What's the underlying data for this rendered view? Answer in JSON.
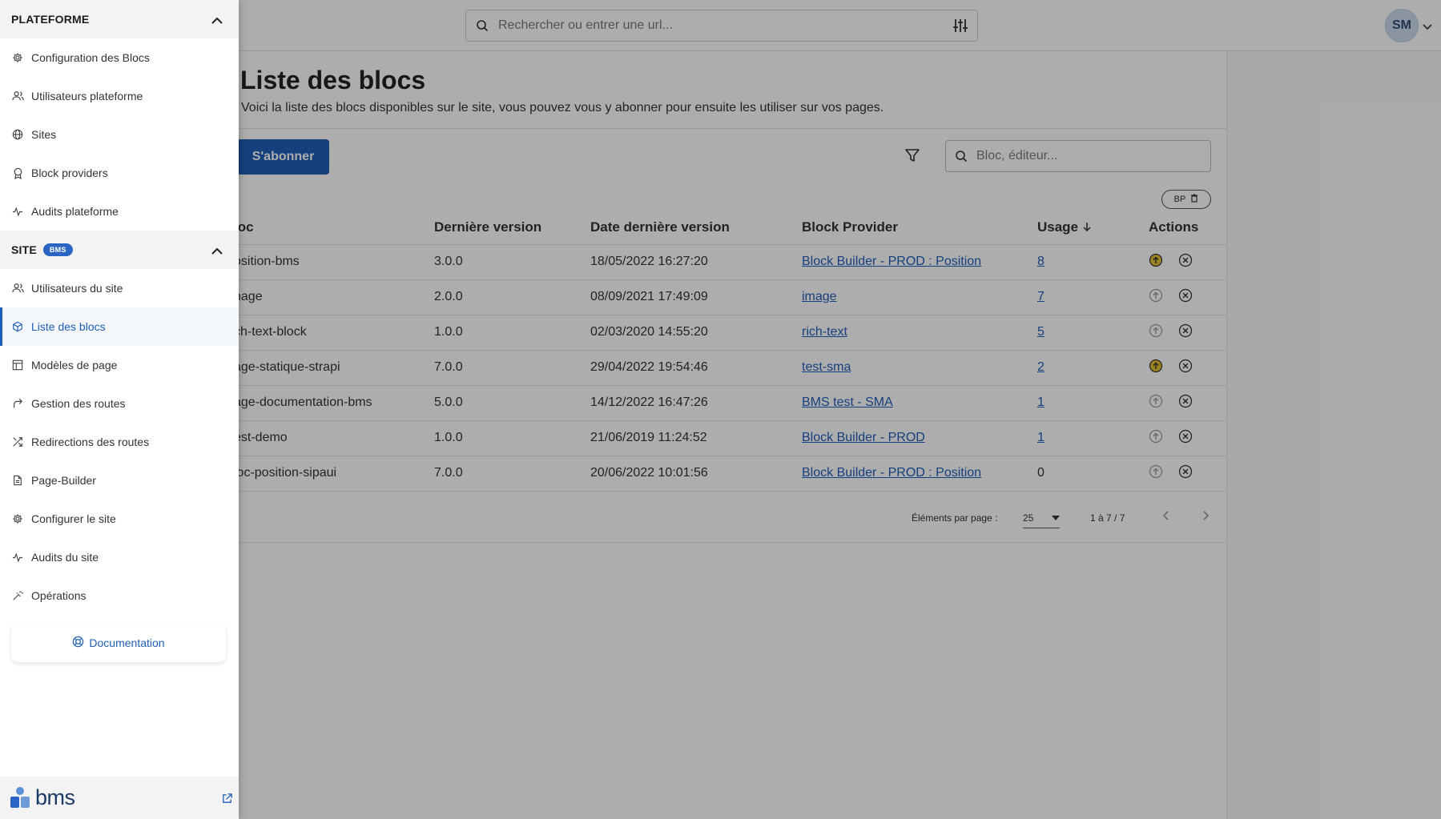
{
  "topbar": {
    "search_placeholder": "Rechercher ou entrer une url...",
    "avatar_initials": "SM"
  },
  "page": {
    "title": "Liste des blocs",
    "description": "Voici la liste des blocs disponibles sur le site, vous pouvez vous y abonner pour ensuite les utiliser sur vos pages.",
    "subscribe_label": "S'abonner",
    "bloc_search_placeholder": "Bloc, éditeur...",
    "bp_chip": "BP"
  },
  "table": {
    "headers": [
      "loc",
      "Dernière version",
      "Date dernière version",
      "Block Provider",
      "Usage",
      "Actions"
    ],
    "rows": [
      {
        "bloc": "osition-bms",
        "version": "3.0.0",
        "date": "18/05/2022 16:27:20",
        "provider": "Block Builder - PROD : Position",
        "usage": "8",
        "upgrade": true
      },
      {
        "bloc": "nage",
        "version": "2.0.0",
        "date": "08/09/2021 17:49:09",
        "provider": "image",
        "usage": "7",
        "upgrade": false
      },
      {
        "bloc": "ch-text-block",
        "version": "1.0.0",
        "date": "02/03/2020 14:55:20",
        "provider": "rich-text",
        "usage": "5",
        "upgrade": false
      },
      {
        "bloc": "age-statique-strapi",
        "version": "7.0.0",
        "date": "29/04/2022 19:54:46",
        "provider": "test-sma",
        "usage": "2",
        "upgrade": true
      },
      {
        "bloc": "age-documentation-bms",
        "version": "5.0.0",
        "date": "14/12/2022 16:47:26",
        "provider": "BMS test - SMA",
        "usage": "1",
        "upgrade": false
      },
      {
        "bloc": "est-demo",
        "version": "1.0.0",
        "date": "21/06/2019 11:24:52",
        "provider": "Block Builder - PROD",
        "usage": "1",
        "upgrade": false
      },
      {
        "bloc": "loc-position-sipaui",
        "version": "7.0.0",
        "date": "20/06/2022 10:01:56",
        "provider": "Block Builder - PROD : Position",
        "usage": "0",
        "upgrade": false
      }
    ]
  },
  "pager": {
    "per_page_label": "Éléments par page :",
    "per_page_value": "25",
    "range": "1 à 7 / 7"
  },
  "sidebar": {
    "platform": {
      "title": "PLATEFORME",
      "items": [
        {
          "label": "Configuration des Blocs",
          "icon": "gear-icon"
        },
        {
          "label": "Utilisateurs plateforme",
          "icon": "users-icon"
        },
        {
          "label": "Sites",
          "icon": "globe-icon"
        },
        {
          "label": "Block providers",
          "icon": "award-icon"
        },
        {
          "label": "Audits plateforme",
          "icon": "activity-icon"
        }
      ]
    },
    "site": {
      "title": "SITE",
      "badge": "BMS",
      "items": [
        {
          "label": "Utilisateurs du site",
          "icon": "users-icon"
        },
        {
          "label": "Liste des blocs",
          "icon": "cube-icon"
        },
        {
          "label": "Modèles de page",
          "icon": "layout-icon"
        },
        {
          "label": "Gestion des routes",
          "icon": "route-icon"
        },
        {
          "label": "Redirections des routes",
          "icon": "shuffle-icon"
        },
        {
          "label": "Page-Builder",
          "icon": "file-icon"
        },
        {
          "label": "Configurer le site",
          "icon": "gear-icon"
        },
        {
          "label": "Audits du site",
          "icon": "activity-icon"
        },
        {
          "label": "Opérations",
          "icon": "wand-icon"
        }
      ]
    },
    "documentation_label": "Documentation",
    "logo_text": "bms"
  },
  "colors": {
    "primary": "#1f5eb8",
    "upgrade": "#e3c233",
    "overlay": "rgba(0,0,0,0.32)"
  }
}
